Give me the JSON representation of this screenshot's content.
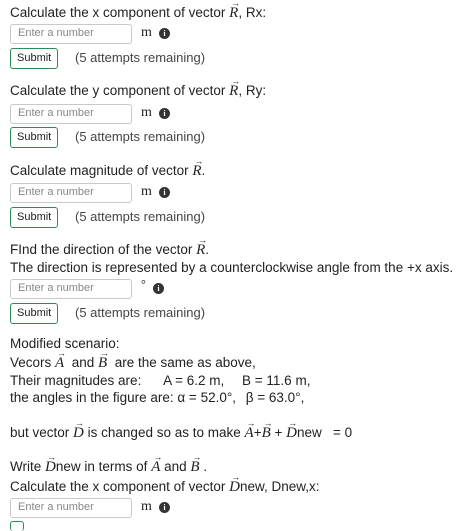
{
  "q1": {
    "prefix": "Calculate the x component of vector",
    "var": "R",
    "suffix": ", Rx:"
  },
  "q2": {
    "prefix": "Calculate the y component of vector",
    "var": "R",
    "suffix": ", Ry:"
  },
  "q3": {
    "prefix": "Calculate magnitude of vector",
    "var": "R",
    "suffix": "."
  },
  "q4": {
    "prefix": "FInd the direction of the vector",
    "var": "R",
    "suffix": ".",
    "line2": "The direction is represented by a counterclockwise angle from the +x axis."
  },
  "input_placeholder": "Enter a number",
  "unit_m": "m",
  "unit_deg": "°",
  "info_glyph": "i",
  "submit_label": "Submit",
  "remaining_text": "(5 attempts remaining)",
  "scenario": {
    "title": "Modified scenario:",
    "line1_a": "Vecors",
    "var_a": "A",
    "line1_b": "and",
    "var_b": "B",
    "line1_c": "are the same  as above,",
    "mag_label": "Their magnitudes are:",
    "mag_a": "A = 6.2 m,",
    "mag_b": "B = 11.6 m,",
    "angles_label": "the angles in the figure are:",
    "alpha": "α = 52.0°,",
    "beta": "β = 63.0°,",
    "changed_prefix": "but vector",
    "var_d": "D",
    "changed_mid": "is changed so as to make",
    "plus1": "+",
    "plus2": "+",
    "dnew_suffix": "new",
    "equals": "= 0",
    "write_prefix": "Write",
    "write_mid": "new in terms of",
    "write_and": "and",
    "write_end": ".",
    "calc_prefix": "Calculate the x component of vector",
    "calc_suffix": "new, Dnew,x:"
  }
}
